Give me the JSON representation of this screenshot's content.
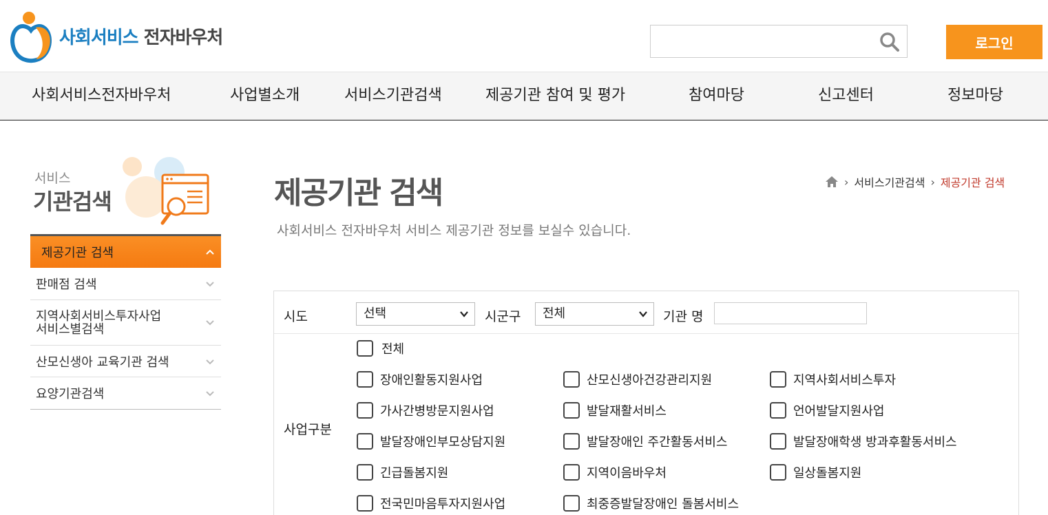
{
  "header": {
    "logo_blue": "사회서비스",
    "logo_dark": "전자바우처",
    "search_placeholder": "",
    "login_label": "로그인",
    "brand_colors": {
      "orange": "#f7941d",
      "blue": "#1b7fc1"
    }
  },
  "gnb": [
    "사회서비스전자바우처",
    "사업별소개",
    "서비스기관검색",
    "제공기관 참여 및 평가",
    "참여마당",
    "신고센터",
    "정보마당"
  ],
  "lnb": {
    "title_small": "서비스",
    "title_big": "기관검색",
    "items": [
      {
        "label": "제공기관 검색",
        "active": true,
        "icon": "chevron-up-icon"
      },
      {
        "label": "판매점 검색",
        "active": false,
        "icon": "chevron-down-icon"
      },
      {
        "label": "지역사회서비스투자사업\n서비스별검색",
        "active": false,
        "icon": "chevron-down-icon"
      },
      {
        "label": "산모신생아 교육기관 검색",
        "active": false,
        "icon": "chevron-down-icon"
      },
      {
        "label": "요양기관검색",
        "active": false,
        "icon": "chevron-down-icon"
      }
    ]
  },
  "content": {
    "title": "제공기관 검색",
    "description": "사회서비스 전자바우처 서비스 제공기관 정보를 보실수 있습니다.",
    "breadcrumb": [
      "서비스기관검색",
      "제공기관 검색"
    ]
  },
  "form": {
    "sido_label": "시도",
    "sido_value": "선택",
    "sigungu_label": "시군구",
    "sigungu_value": "전체",
    "org_name_label": "기관 명",
    "org_name_value": "",
    "biz_label": "사업구분",
    "all_label": "전체",
    "checkboxes": [
      "장애인활동지원사업",
      "산모신생아건강관리지원",
      "지역사회서비스투자",
      "가사간병방문지원사업",
      "발달재활서비스",
      "언어발달지원사업",
      "발달장애인부모상담지원",
      "발달장애인 주간활동서비스",
      "발달장애학생 방과후활동서비스",
      "긴급돌봄지원",
      "지역이음바우처",
      "일상돌봄지원",
      "전국민마음투자지원사업",
      "최중증발달장애인 돌봄서비스"
    ]
  }
}
